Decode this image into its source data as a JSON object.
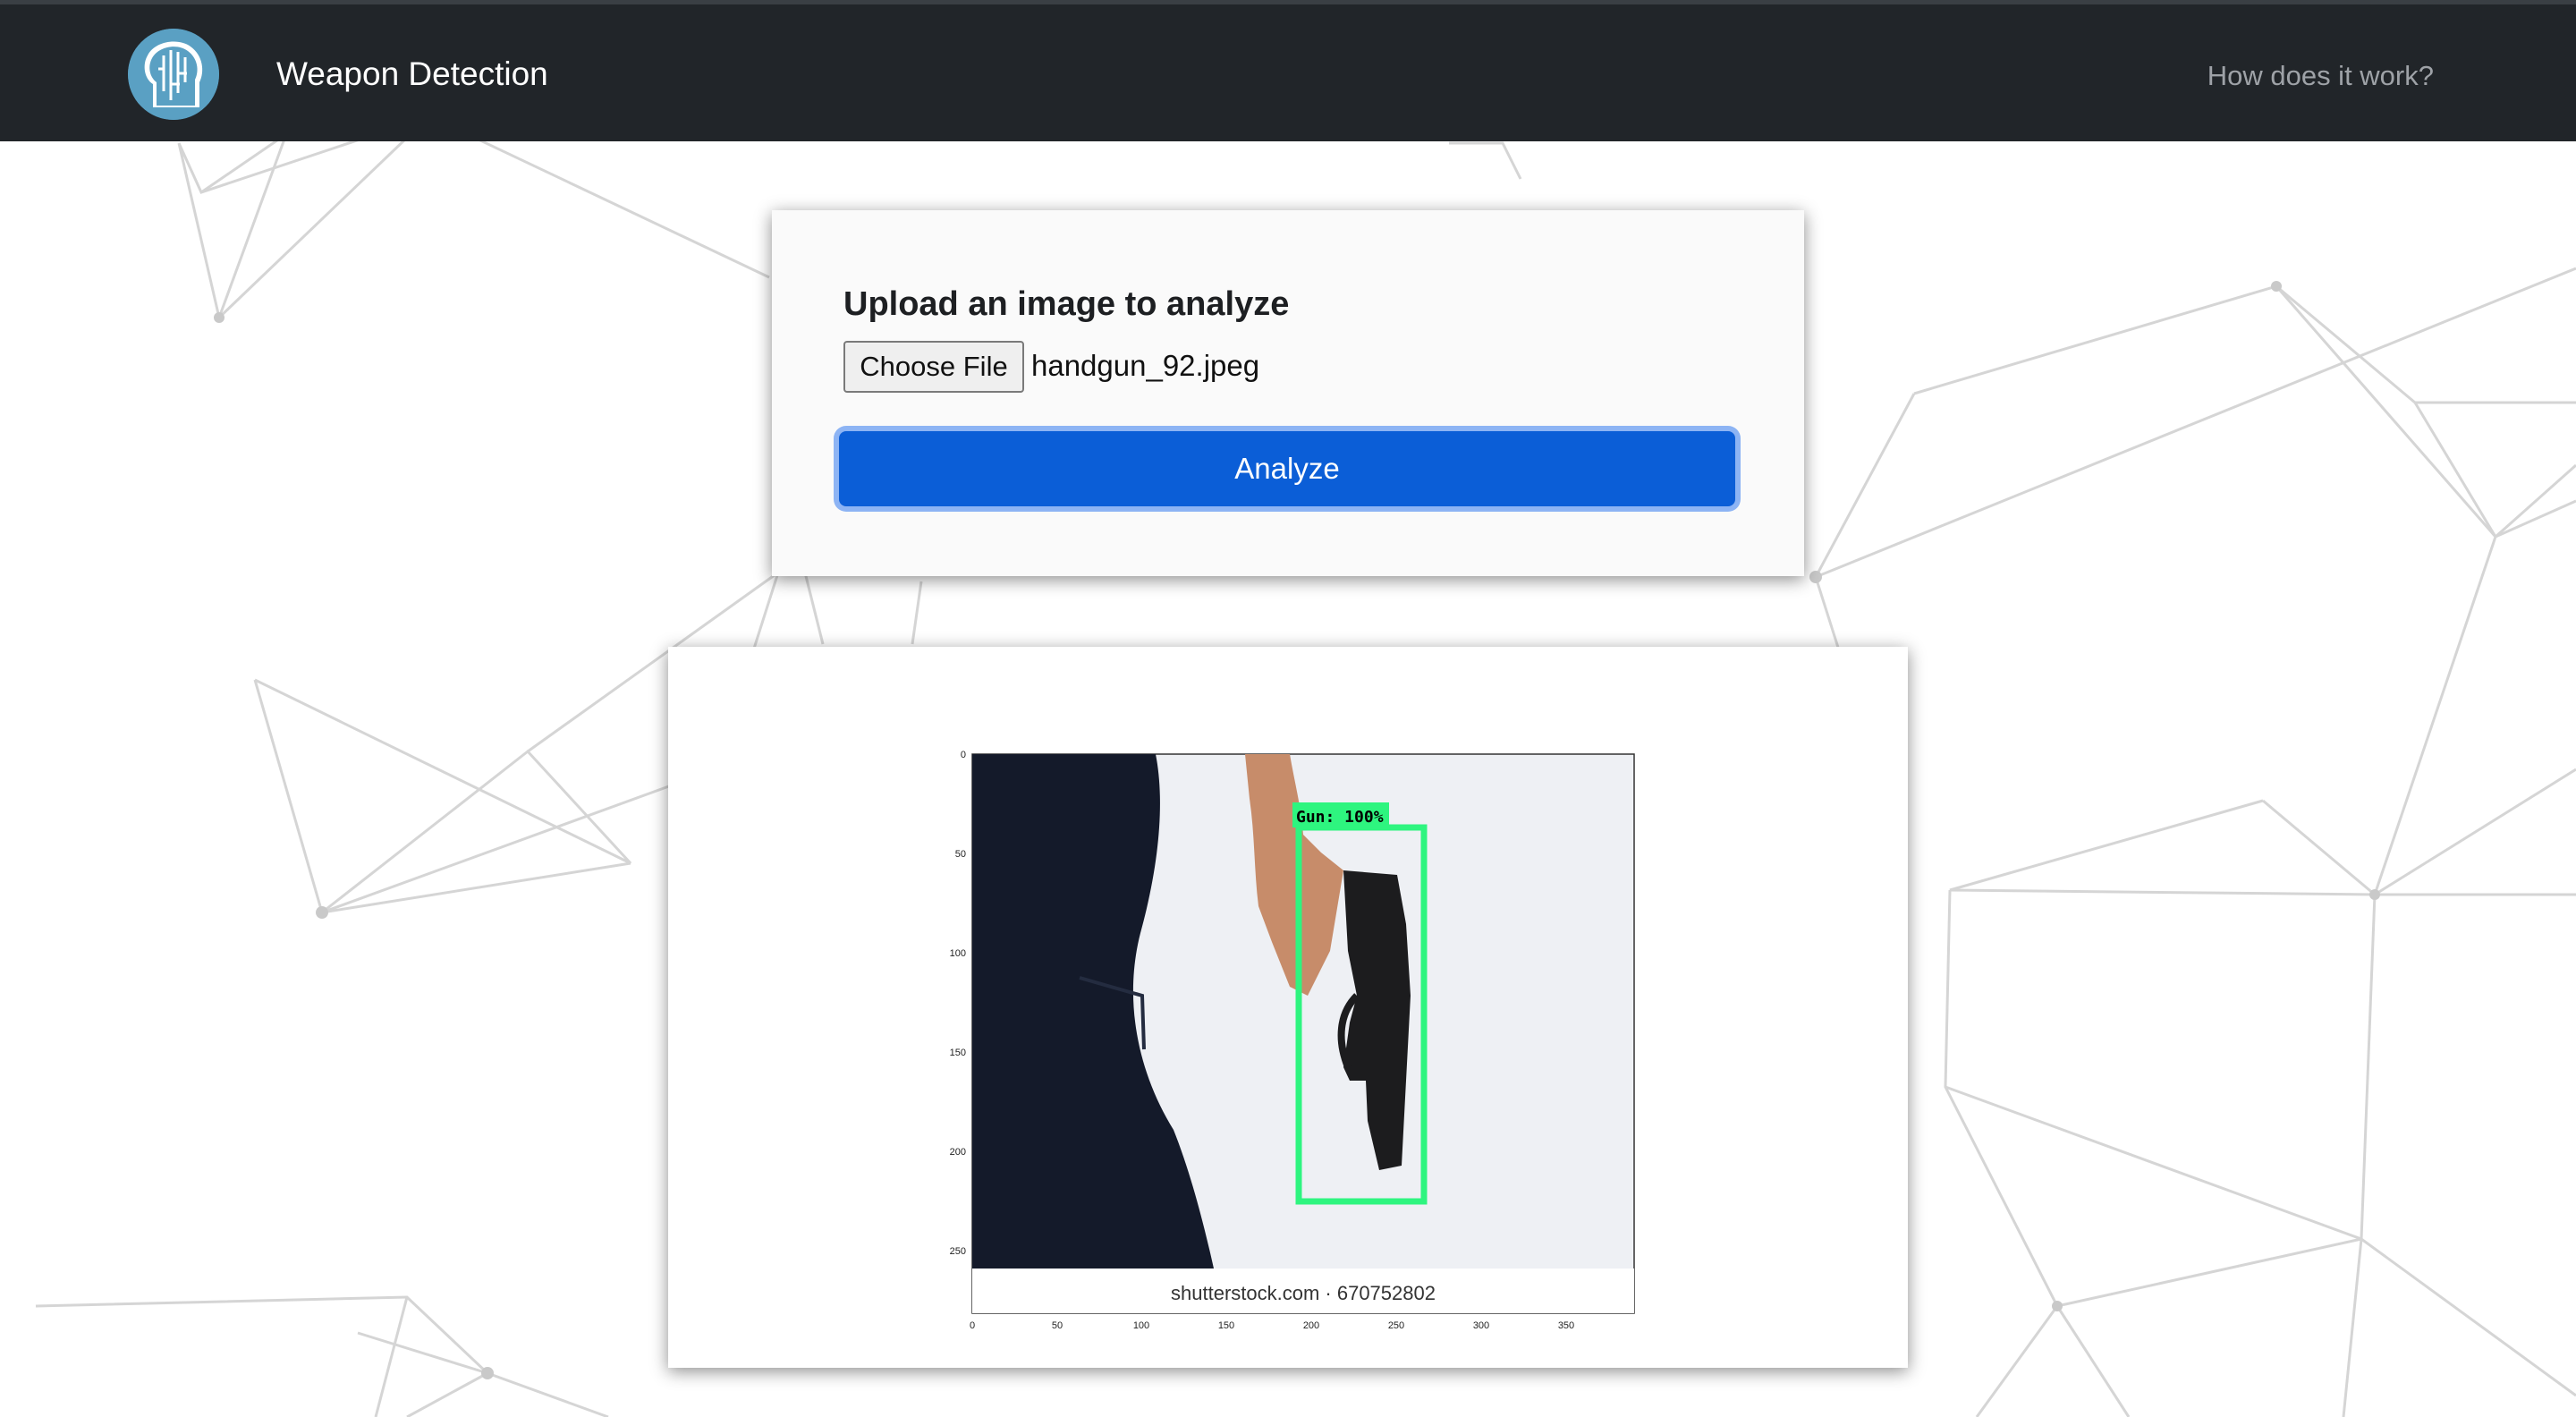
{
  "navbar": {
    "brand": "Weapon Detection",
    "logo_icon": "brain-head-icon",
    "help_link": "How does it work?"
  },
  "upload": {
    "title": "Upload an image to analyze",
    "choose_file_label": "Choose File",
    "file_name": "handgun_92.jpeg",
    "analyze_label": "Analyze"
  },
  "result": {
    "detection_label": "Gun: 100%",
    "watermark": "shutterstock.com · 670752802",
    "y_ticks": [
      "0",
      "50",
      "100",
      "150",
      "200",
      "250"
    ],
    "x_ticks": [
      "0",
      "50",
      "100",
      "150",
      "200",
      "250",
      "300",
      "350"
    ],
    "box_color": "#2ef57f"
  },
  "colors": {
    "navbar_bg": "#212529",
    "primary": "#0b5ed7"
  }
}
